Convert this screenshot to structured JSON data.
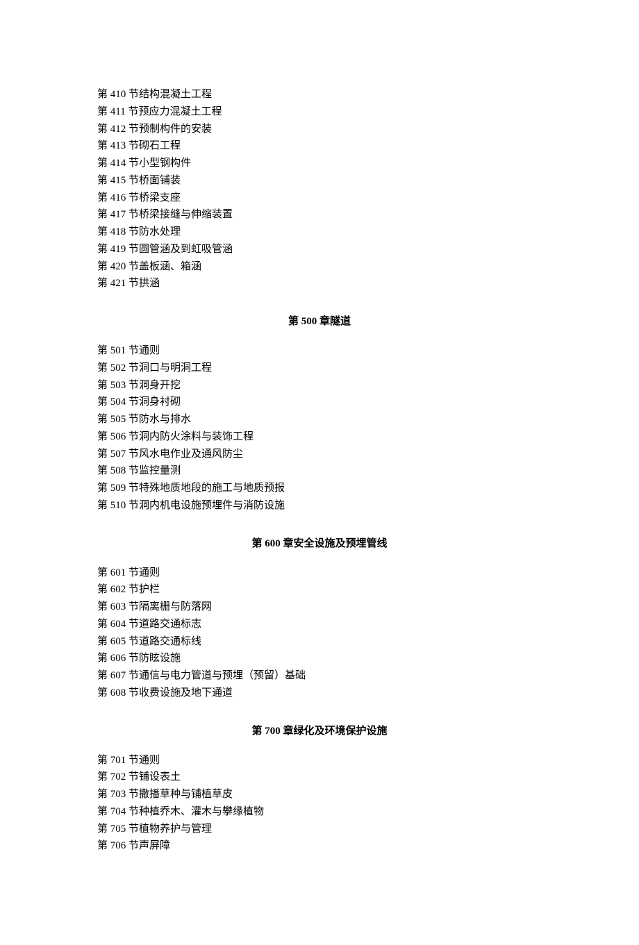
{
  "sections": [
    {
      "items": [
        "第 410 节结构混凝土工程",
        "第 411 节预应力混凝土工程",
        "第 412 节预制构件的安装",
        "第 413 节砌石工程",
        "第 414 节小型钢构件",
        "第 415 节桥面铺装",
        "第 416 节桥梁支座",
        "第 417 节桥梁接缝与伸缩装置",
        "第 418 节防水处理",
        "第 419 节圆管涵及到虹吸管涵",
        "第 420 节盖板涵、箱涵",
        "第 421 节拱涵"
      ]
    },
    {
      "heading_prefix": "第",
      "heading_num": " 500 ",
      "heading_suffix": "章隧道",
      "items": [
        "第 501 节通则",
        "第 502 节洞口与明洞工程",
        "第 503 节洞身开挖",
        "第 504 节洞身衬砌",
        "第 505 节防水与排水",
        "第 506 节洞内防火涂料与装饰工程",
        "第 507 节风水电作业及通风防尘",
        "第 508 节监控量测",
        "第 509 节特殊地质地段的施工与地质预报",
        "第 510 节洞内机电设施预埋件与消防设施"
      ]
    },
    {
      "heading_prefix": "第",
      "heading_num": " 600 ",
      "heading_suffix": "章安全设施及预埋管线",
      "items": [
        "第 601 节通则",
        "第 602 节护栏",
        "第 603 节隔离栅与防落网",
        "第 604 节道路交通标志",
        "第 605 节道路交通标线",
        "第 606 节防眩设施",
        "第 607 节通信与电力管道与预埋（预留）基础",
        "第 608 节收费设施及地下通道"
      ]
    },
    {
      "heading_prefix": "第",
      "heading_num": " 700 ",
      "heading_suffix": "章绿化及环境保护设施",
      "items": [
        "第 701 节通则",
        "第 702 节铺设表土",
        "第 703 节撒播草种与铺植草皮",
        "第 704 节种植乔木、灌木与攀缘植物",
        "第 705 节植物养护与管理",
        "第 706 节声屏障"
      ]
    }
  ]
}
